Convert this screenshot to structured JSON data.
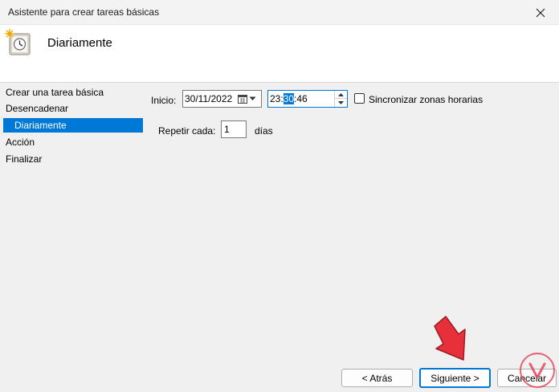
{
  "window": {
    "title": "Asistente para crear tareas básicas"
  },
  "header": {
    "title": "Diariamente"
  },
  "sidebar": {
    "items": [
      {
        "label": "Crear una tarea básica",
        "active": false
      },
      {
        "label": "Desencadenar",
        "active": false
      },
      {
        "label": "Diariamente",
        "active": true
      },
      {
        "label": "Acción",
        "active": false
      },
      {
        "label": "Finalizar",
        "active": false
      }
    ]
  },
  "form": {
    "start_label": "Inicio:",
    "start_date": "30/11/2022",
    "start_time_hour": "23:",
    "start_time_minute": "30",
    "start_time_second": ":46",
    "sync_label": "Sincronizar zonas horarias",
    "sync_checked": false,
    "repeat_label": "Repetir cada:",
    "repeat_value": "1",
    "repeat_unit": "días"
  },
  "buttons": {
    "back": "< Atrás",
    "next": "Siguiente >",
    "cancel": "Cancelar"
  },
  "colors": {
    "accent": "#0078d7",
    "arrow": "#e8303a",
    "watermark": "#e5485c"
  }
}
